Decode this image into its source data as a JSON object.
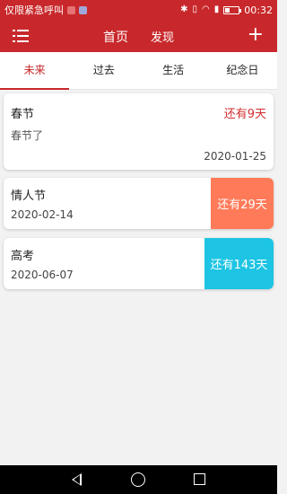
{
  "status_bar": {
    "carrier": "仅限紧急呼叫",
    "time": "00:32",
    "icons": [
      "notification-icon",
      "image-icon",
      "bluetooth-icon",
      "vibrate-icon",
      "wifi-icon",
      "sim-icon",
      "battery-icon"
    ]
  },
  "header": {
    "menu_icon": "menu-list-icon",
    "tab_home": "首页",
    "tab_discover": "发现",
    "add_icon": "plus-icon"
  },
  "tabs": [
    {
      "label": "未来",
      "active": true
    },
    {
      "label": "过去",
      "active": false
    },
    {
      "label": "生活",
      "active": false
    },
    {
      "label": "纪念日",
      "active": false
    }
  ],
  "events": [
    {
      "title": "春节",
      "description": "春节了",
      "date": "2020-01-25",
      "countdown": "还有9天"
    },
    {
      "title": "情人节",
      "date": "2020-02-14",
      "countdown": "还有29天",
      "badge_color": "#ff7a59"
    },
    {
      "title": "高考",
      "date": "2020-06-07",
      "countdown": "还有143天",
      "badge_color": "#1dc4e3"
    }
  ],
  "colors": {
    "accent": "#c8282b",
    "countdown_text": "#d32f2f",
    "background": "#f2f2f2"
  }
}
